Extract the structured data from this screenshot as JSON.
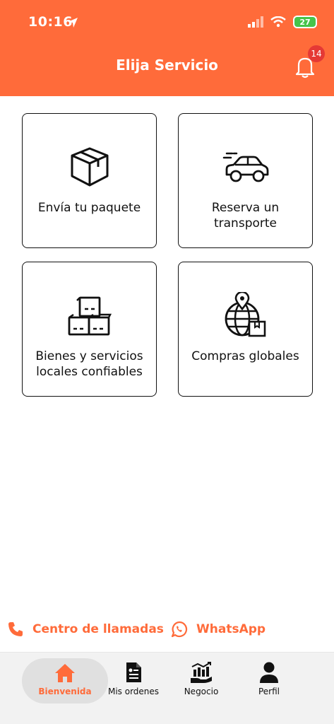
{
  "status_bar": {
    "time": "10:16",
    "battery": "27"
  },
  "header": {
    "title": "Elija Servicio",
    "notification_count": "14"
  },
  "services": [
    {
      "label": "Envía tu paquete",
      "icon": "package-icon"
    },
    {
      "label": "Reserva un transporte",
      "icon": "car-icon"
    },
    {
      "label_line1": "Bienes y servicios",
      "label_line2": "locales confiables",
      "icon": "boxes-icon"
    },
    {
      "label": "Compras globales",
      "icon": "globe-icon"
    }
  ],
  "contacts": {
    "call_center": "Centro de llamadas",
    "whatsapp": "WhatsApp"
  },
  "tabs": [
    {
      "label": "Bienvenida",
      "active": true
    },
    {
      "label": "Mis ordenes"
    },
    {
      "label": "Negocio"
    },
    {
      "label": "Perfil"
    }
  ],
  "colors": {
    "accent": "#ff6b3a",
    "badge": "#e53935",
    "battery": "#46c44a"
  }
}
